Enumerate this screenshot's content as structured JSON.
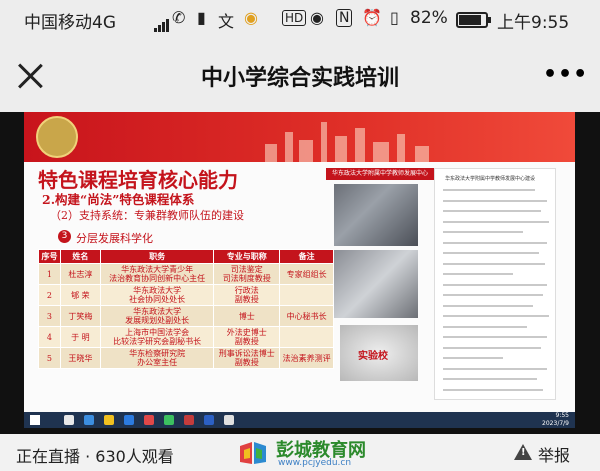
{
  "status_bar": {
    "carrier": "中国移动4G",
    "signal_label": "4G",
    "battery_pct": "82%",
    "time": "上午9:55",
    "icons": [
      "call-icon",
      "sim-icon",
      "translate-icon",
      "app-icon",
      "hd-icon",
      "eye-icon",
      "nfc-icon",
      "alarm-icon",
      "vibrate-icon"
    ]
  },
  "title_bar": {
    "title": "中小学综合实践培训",
    "more": "•••"
  },
  "slide": {
    "title": "特色课程培育核心能力",
    "sub1": "2.构建“尚法”特色课程体系",
    "sub2": "（2）支持系统：专兼群教师队伍的建设",
    "layer_badge": "3",
    "layer_text": "分层发展科学化",
    "right_caption": "华东政法大学附属中学教师发展中心",
    "plaque_text": "实验校",
    "doc_title": "华东政法大学附属中学教师发展中心建设",
    "table": {
      "headers": [
        "序号",
        "姓名",
        "职务",
        "专业与职称",
        "备注"
      ],
      "rows": [
        [
          "1",
          "杜志淳",
          "华东政法大学青少年\n法治教育协同创新中心主任",
          "司法鉴定\n司法制度教授",
          "专家组组长"
        ],
        [
          "2",
          "郇 荣",
          "华东政法大学\n社会协同处处长",
          "行政法\n副教授",
          ""
        ],
        [
          "3",
          "丁笑梅",
          "华东政法大学\n发展规划处副处长",
          "博士",
          "中心秘书长"
        ],
        [
          "4",
          "于 明",
          "上海市中国法学会\n比较法学研究会副秘书长",
          "外法史博士\n副教授",
          ""
        ],
        [
          "5",
          "王晓华",
          "华东检察研究院\n办公室主任",
          "刑事诉讼法博士\n副教授",
          "法治素养测评"
        ]
      ]
    },
    "taskbar_time": "9:55",
    "taskbar_date": "2023/7/9"
  },
  "bottom_bar": {
    "live_text": "正在直播 · 630人观看",
    "brand_name": "彭城教育网",
    "brand_url": "www.pcjyedu.cn",
    "report": "举报"
  },
  "colors": {
    "slide_red": "#c4141c",
    "table_cell": "#f7ecd4",
    "brand_green": "#2c8a2c",
    "taskbar": "#1f3350"
  }
}
